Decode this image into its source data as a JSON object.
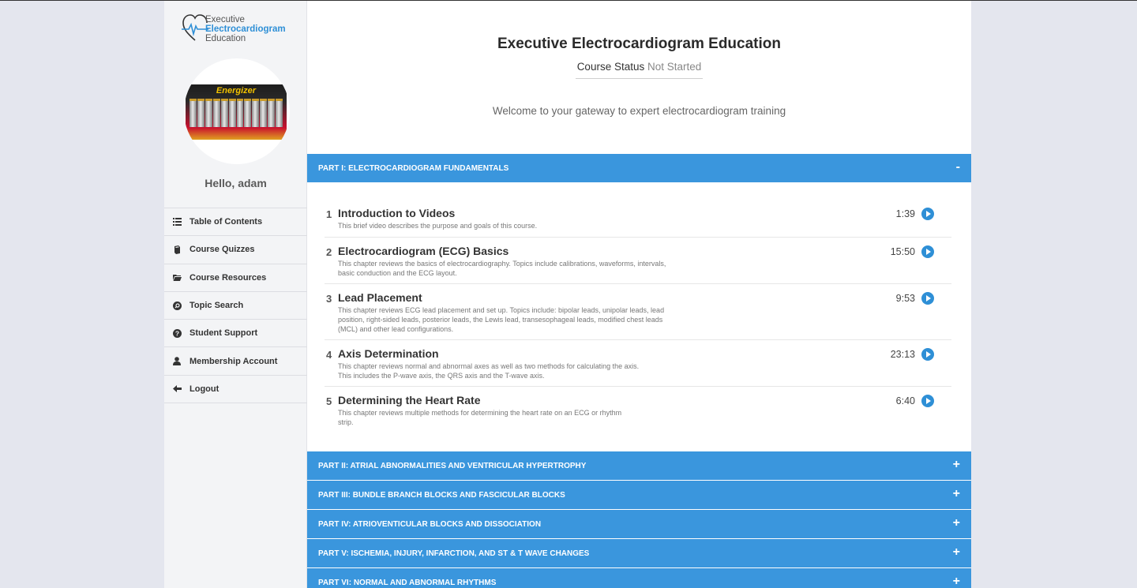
{
  "brand": {
    "line1": "Executive",
    "line2": "Electrocardiogram",
    "line3": "Education",
    "accent_color": "#2e8fd6"
  },
  "sidebar": {
    "greeting": "Hello, adam",
    "avatar_image": "Energizer battery pack",
    "items": [
      {
        "label": "Table of Contents",
        "icon": "list-icon"
      },
      {
        "label": "Course Quizzes",
        "icon": "book-icon"
      },
      {
        "label": "Course Resources",
        "icon": "folder-icon"
      },
      {
        "label": "Topic Search",
        "icon": "search-circle-icon"
      },
      {
        "label": "Student Support",
        "icon": "question-circle-icon"
      },
      {
        "label": "Membership Account",
        "icon": "user-icon"
      },
      {
        "label": "Logout",
        "icon": "arrow-left-icon"
      }
    ]
  },
  "main": {
    "title": "Executive Electrocardiogram Education",
    "status_label": "Course Status",
    "status_value": "Not Started",
    "welcome": "Welcome to your gateway to expert electrocardiogram training",
    "part_color": "#3a96dd",
    "parts": [
      {
        "title": "PART I: ELECTROCARDIOGRAM FUNDAMENTALS",
        "toggle": "-"
      },
      {
        "title": "PART II: ATRIAL ABNORMALITIES AND VENTRICULAR HYPERTROPHY",
        "toggle": "+"
      },
      {
        "title": "PART III: BUNDLE BRANCH BLOCKS AND FASCICULAR BLOCKS",
        "toggle": "+"
      },
      {
        "title": "PART IV: ATRIOVENTICULAR BLOCKS AND DISSOCIATION",
        "toggle": "+"
      },
      {
        "title": "PART V: ISCHEMIA, INJURY, INFARCTION, AND ST & T WAVE CHANGES",
        "toggle": "+"
      },
      {
        "title": "PART VI: NORMAL AND ABNORMAL RHYTHMS",
        "toggle": "+"
      }
    ],
    "lessons": [
      {
        "num": "1",
        "title": "Introduction to Videos",
        "desc": "This brief video describes the purpose and goals of this course.",
        "duration": "1:39"
      },
      {
        "num": "2",
        "title": "Electrocardiogram (ECG) Basics",
        "desc": "This chapter reviews the basics of electrocardiography. Topics include calibrations, waveforms, intervals, basic conduction and the ECG layout.",
        "duration": "15:50"
      },
      {
        "num": "3",
        "title": "Lead Placement",
        "desc": "This chapter reviews ECG lead placement and set up. Topics include: bipolar leads, unipolar leads, lead position, right-sided leads, posterior leads, the Lewis lead, transesophageal leads, modified chest leads (MCL) and other lead configurations.",
        "duration": "9:53"
      },
      {
        "num": "4",
        "title": "Axis Determination",
        "desc": "This chapter reviews normal and abnormal axes as well as two methods for calculating the axis. This includes the P-wave axis, the QRS axis and the T-wave axis.",
        "duration": "23:13"
      },
      {
        "num": "5",
        "title": "Determining the Heart Rate",
        "desc": "This chapter reviews multiple methods for determining the heart rate on an ECG or rhythm strip.",
        "duration": "6:40"
      }
    ]
  }
}
